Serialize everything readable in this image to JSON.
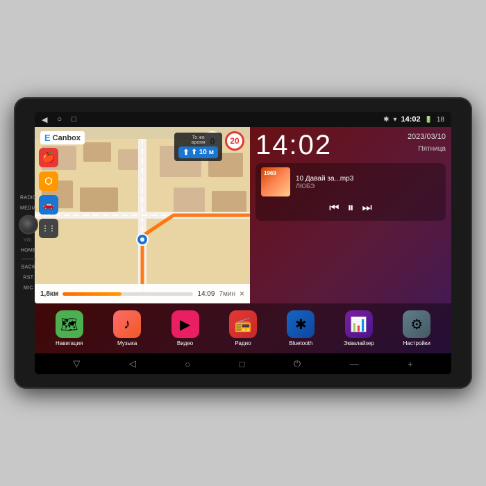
{
  "device": {
    "background_color": "#c8c8c8"
  },
  "status_bar": {
    "nav_icons": [
      "◀",
      "○",
      "□"
    ],
    "bluetooth_icon": "✱",
    "wifi_icon": "▾",
    "time": "14:02",
    "battery_level": "18"
  },
  "map": {
    "logo": "Canbox",
    "logo_prefix": "E",
    "speed_current": "0",
    "speed_limit": "20",
    "instruction_label": "То же\nвремя",
    "instruction_distance": "⬆ 10 м",
    "route_distance": "1,8км",
    "route_time_current": "14:09",
    "route_time_remaining": "7мин",
    "route_close_btn": "×"
  },
  "clock": {
    "time": "14:02",
    "date": "2023/03/10",
    "weekday": "Пятница"
  },
  "music": {
    "album_label": "1969",
    "track_title": "10 Давай за...mp3",
    "track_artist": "ЛЮБЭ",
    "ctrl_prev": "⏮",
    "ctrl_play": "⏸",
    "ctrl_next": "⏭"
  },
  "apps": [
    {
      "id": "nav",
      "label": "Навигация",
      "icon": "🗺",
      "icon_class": "icon-nav"
    },
    {
      "id": "music",
      "label": "Музыка",
      "icon": "♪",
      "icon_class": "icon-music"
    },
    {
      "id": "video",
      "label": "Видео",
      "icon": "▶",
      "icon_class": "icon-video"
    },
    {
      "id": "radio",
      "label": "Радио",
      "icon": "📻",
      "icon_class": "icon-radio"
    },
    {
      "id": "bluetooth",
      "label": "Bluetooth",
      "icon": "✱",
      "icon_class": "icon-bt"
    },
    {
      "id": "equalizer",
      "label": "Эквалайзер",
      "icon": "📊",
      "icon_class": "icon-eq"
    },
    {
      "id": "settings",
      "label": "Настройки",
      "icon": "⚙",
      "icon_class": "icon-settings"
    }
  ],
  "bottom_nav": {
    "buttons": [
      "▽",
      "◁",
      "○",
      "□",
      "⏻",
      "—",
      "+"
    ]
  },
  "side_buttons": {
    "top": [
      "RADIO",
      "MEDIA",
      "HOME",
      "BACK",
      "RST",
      "MIC"
    ],
    "vol_label": "VOL"
  },
  "left_apps": [
    {
      "id": "carplay",
      "icon": "🍎",
      "bg": "#e53935"
    },
    {
      "id": "waze",
      "icon": "⬡",
      "bg": "#FF9800"
    },
    {
      "id": "car",
      "icon": "🚗",
      "bg": "#1976D2"
    },
    {
      "id": "grid",
      "icon": "⋮⋮",
      "bg": "#333"
    }
  ]
}
